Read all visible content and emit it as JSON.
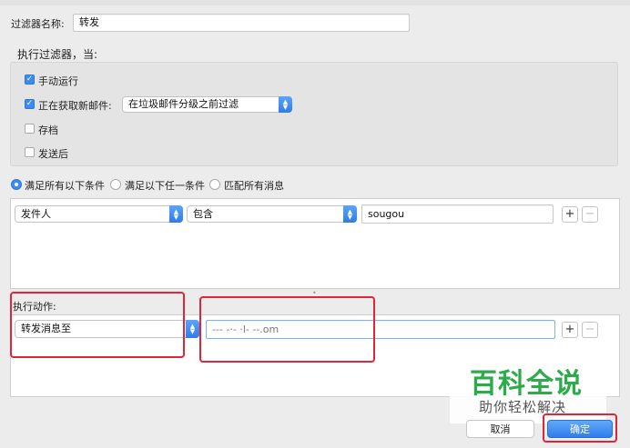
{
  "filter": {
    "name_label": "过滤器名称:",
    "name_value": "转发"
  },
  "run_section": {
    "title": "执行过滤器，当:",
    "manual": {
      "label": "手动运行",
      "checked": true
    },
    "fetching": {
      "label": "正在获取新邮件:",
      "checked": true,
      "option": "在垃圾邮件分级之前过滤"
    },
    "archive": {
      "label": "存档",
      "checked": false
    },
    "after_send": {
      "label": "发送后",
      "checked": false
    }
  },
  "match": {
    "options": [
      {
        "label": "满足所有以下条件",
        "selected": true
      },
      {
        "label": "满足以下任一条件",
        "selected": false
      },
      {
        "label": "匹配所有消息",
        "selected": false
      }
    ]
  },
  "condition": {
    "field": "发件人",
    "operator": "包含",
    "value": "sougou"
  },
  "actions": {
    "title": "执行动作:",
    "action": "转发消息至",
    "target_value": "--- -·- ·l- --.om"
  },
  "buttons": {
    "add": "+",
    "remove": "−",
    "cancel": "取消",
    "ok": "确定"
  },
  "watermark": {
    "title": "百科全说",
    "subtitle": "助你轻松解决"
  },
  "colors": {
    "accent": "#3d8bf0",
    "highlight": "#e0243a",
    "watermark": "#2cab4b"
  }
}
